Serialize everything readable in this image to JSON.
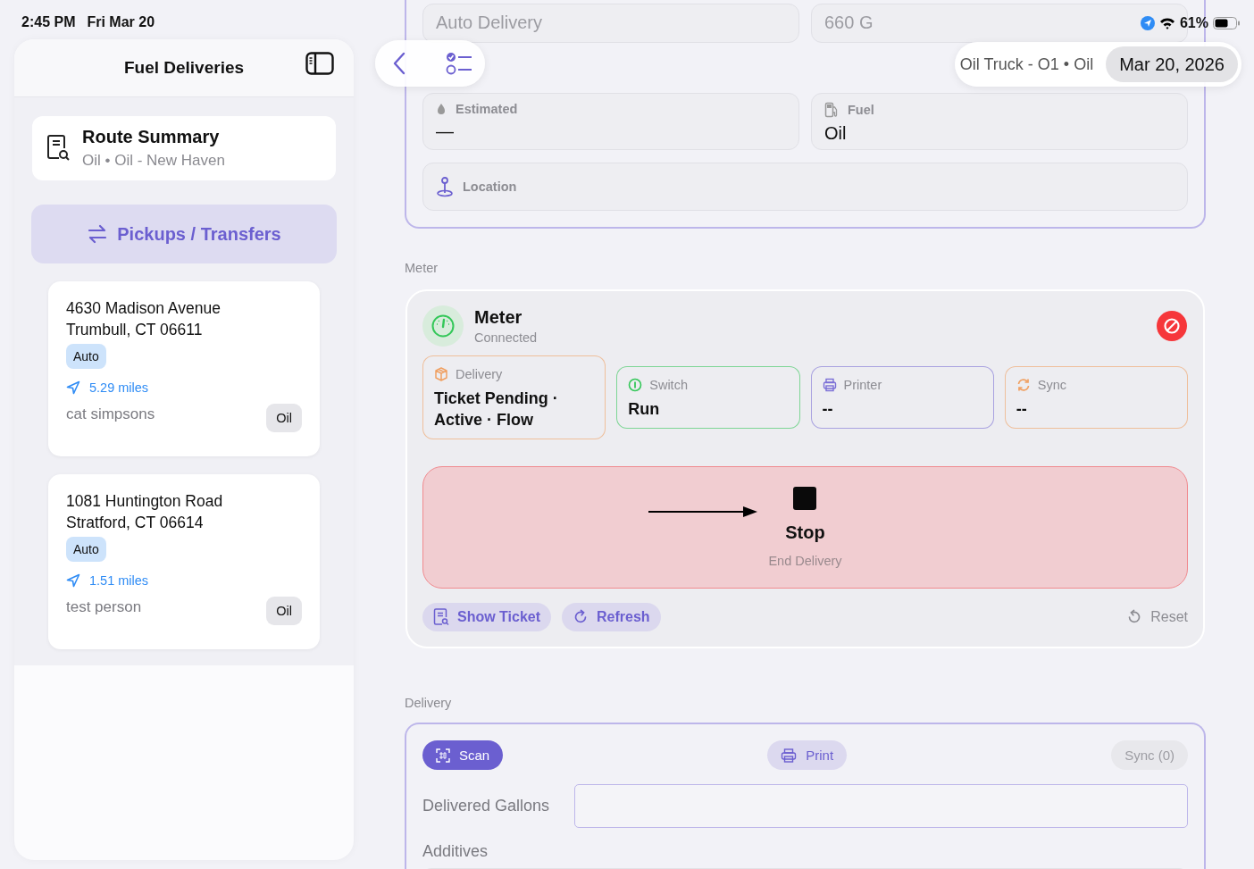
{
  "status_bar": {
    "time": "2:45 PM",
    "date": "Fri Mar 20",
    "battery": "61%"
  },
  "sidebar": {
    "title": "Fuel Deliveries",
    "route_summary": {
      "title": "Route Summary",
      "subtitle": "Oil • Oil - New Haven"
    },
    "pickups_button": "Pickups / Transfers",
    "deliveries": [
      {
        "address_line1": "4630 Madison Avenue",
        "address_line2": "Trumbull, CT 06611",
        "tag": "Auto",
        "distance": "5.29 miles",
        "customer": "cat simpsons",
        "fuel": "Oil"
      },
      {
        "address_line1": "1081 Huntington Road",
        "address_line2": "Stratford, CT 06614",
        "tag": "Auto",
        "distance": "1.51 miles",
        "customer": "test person",
        "fuel": "Oil"
      }
    ]
  },
  "toolbar": {
    "vehicle": "Oil Truck - O1 • Oil",
    "date": "Mar 20, 2026"
  },
  "tank_fields": [
    {
      "value": "Auto Delivery"
    },
    {
      "value": "660 G"
    },
    {
      "label": "Estimated",
      "value": "—"
    },
    {
      "label": "Fuel",
      "value": "Oil"
    },
    {
      "label": "Location"
    }
  ],
  "meter": {
    "section_label": "Meter",
    "title": "Meter",
    "status": "Connected",
    "statuses": [
      {
        "label": "Delivery",
        "value": "Ticket Pending · Active · Flow",
        "color": "#f0a062"
      },
      {
        "label": "Switch",
        "value": "Run",
        "color": "#34c759"
      },
      {
        "label": "Printer",
        "value": "--",
        "color": "#7b6fd6"
      },
      {
        "label": "Sync",
        "value": "--",
        "color": "#f0a062"
      }
    ],
    "stop": {
      "title": "Stop",
      "subtitle": "End Delivery"
    },
    "actions": [
      {
        "label": "Show Ticket",
        "kind": "tinted"
      },
      {
        "label": "Refresh",
        "kind": "tinted"
      },
      {
        "label": "Reset",
        "kind": "plain"
      }
    ]
  },
  "delivery": {
    "section_label": "Delivery",
    "buttons": [
      {
        "label": "Scan",
        "kind": "primary",
        "disabled": false
      },
      {
        "label": "Print",
        "kind": "tinted",
        "disabled": false
      },
      {
        "label": "Sync (0)",
        "kind": "plain",
        "disabled": true
      }
    ],
    "gallons_label": "Delivered Gallons",
    "additives_label": "Additives"
  }
}
